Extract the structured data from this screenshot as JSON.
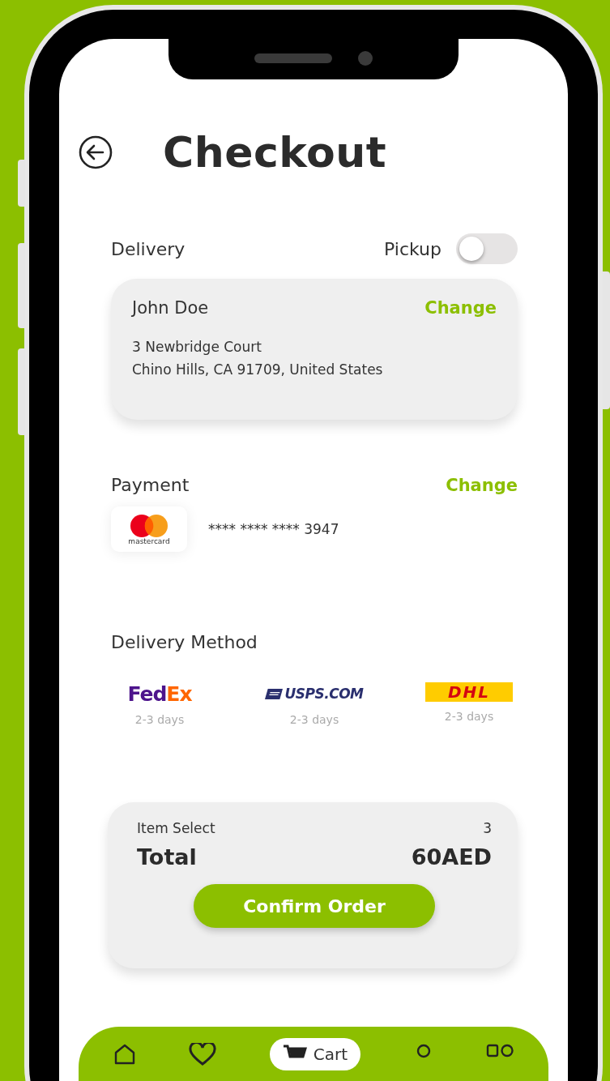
{
  "header": {
    "title": "Checkout"
  },
  "delivery": {
    "label": "Delivery",
    "pickup_label": "Pickup",
    "pickup_on": false,
    "name": "John Doe",
    "change": "Change",
    "line_1": "3 Newbridge Court",
    "line_2": "Chino Hills, CA 91709, United States"
  },
  "payment": {
    "label": "Payment",
    "change": "Change",
    "card_brand": "mastercard",
    "card_number": "**** **** **** 3947"
  },
  "delivery_method": {
    "label": "Delivery Method",
    "carriers": [
      {
        "kind": "fedex",
        "name_parts": [
          "Fed",
          "Ex"
        ],
        "eta": "2-3 days"
      },
      {
        "kind": "usps",
        "name_parts": [
          "USPS.COM"
        ],
        "eta": "2-3 days"
      },
      {
        "kind": "dhl",
        "name_parts": [
          "DHL"
        ],
        "eta": "2-3 days"
      }
    ]
  },
  "summary": {
    "items_label": "Item Select",
    "items_count": "3",
    "total_label": "Total",
    "total": "60AED",
    "confirm": "Confirm Order"
  },
  "nav": [
    {
      "kind": "home",
      "selected": false
    },
    {
      "kind": "heart",
      "selected": false
    },
    {
      "kind": "cart",
      "label": "Cart",
      "selected": true
    },
    {
      "kind": "profile",
      "selected": false
    },
    {
      "kind": "apps",
      "selected": false
    }
  ]
}
